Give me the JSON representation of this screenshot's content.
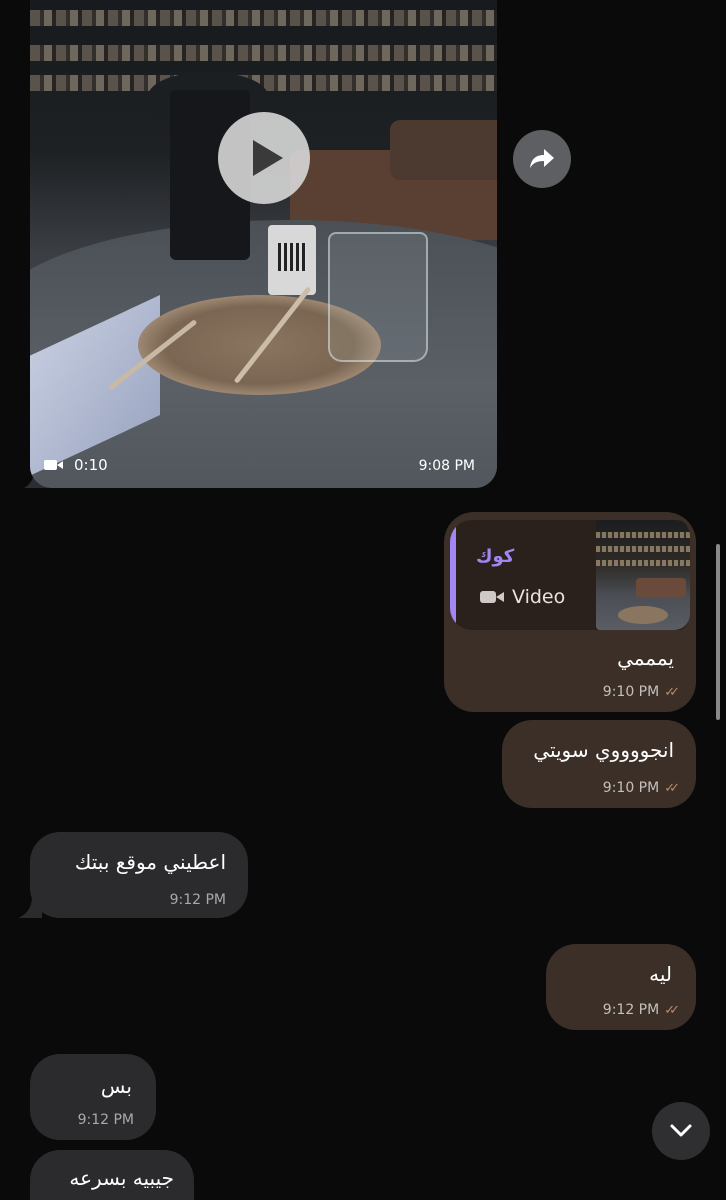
{
  "video_message": {
    "duration": "0:10",
    "time": "9:08 PM",
    "icons": {
      "play": "play-icon",
      "camera": "video-camera-icon",
      "forward": "forward-icon"
    }
  },
  "messages": [
    {
      "direction": "outgoing",
      "reply": {
        "name": "كوك",
        "type_label": "Video"
      },
      "text": "يمممي",
      "time": "9:10 PM",
      "status": "read-double-check"
    },
    {
      "direction": "outgoing",
      "text": "انجووووي سويتي",
      "time": "9:10 PM",
      "status": "read-double-check"
    },
    {
      "direction": "incoming",
      "text": "اعطيني موقع ببتك",
      "time": "9:12 PM"
    },
    {
      "direction": "outgoing",
      "text": "ليه",
      "time": "9:12 PM",
      "status": "read-double-check"
    },
    {
      "direction": "incoming",
      "text": "بس",
      "time": "9:12 PM"
    },
    {
      "direction": "incoming",
      "text": "جيبيه بسرعه",
      "time": ""
    }
  ],
  "ticks_glyph": "✓✓",
  "colors": {
    "background": "#0a0a0a",
    "outgoing_bubble": "#3b2f28",
    "incoming_bubble": "#2b2b2d",
    "reply_accent": "#a287f4",
    "read_ticks": "#b78a6a"
  },
  "scroll_down_icon": "chevron-down-icon"
}
